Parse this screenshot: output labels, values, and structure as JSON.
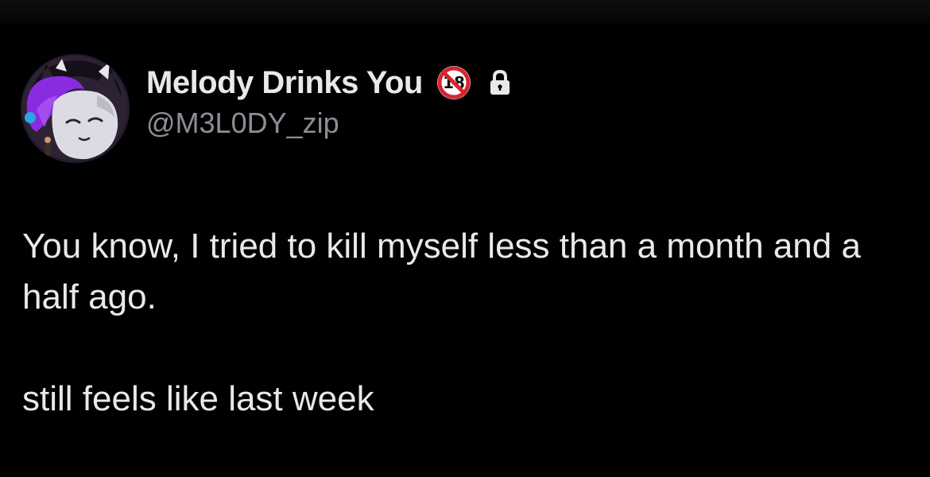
{
  "tweet": {
    "author": {
      "display_name": "Melody Drinks You",
      "handle": "@M3L0DY_zip",
      "avatar_icon": "avatar-icon",
      "age_restricted_badge_icon": "no-under-18-icon",
      "protected_account_icon": "lock-icon"
    },
    "text": {
      "paragraph_1": "You know, I tried to kill myself less than a month and a half ago.",
      "paragraph_2": "still feels like last week"
    }
  },
  "colors": {
    "background": "#000000",
    "primary_text": "#e7e9ea",
    "secondary_text": "#8b8f95",
    "badge_red": "#d8242f",
    "avatar_accent": "#8a2be2"
  }
}
